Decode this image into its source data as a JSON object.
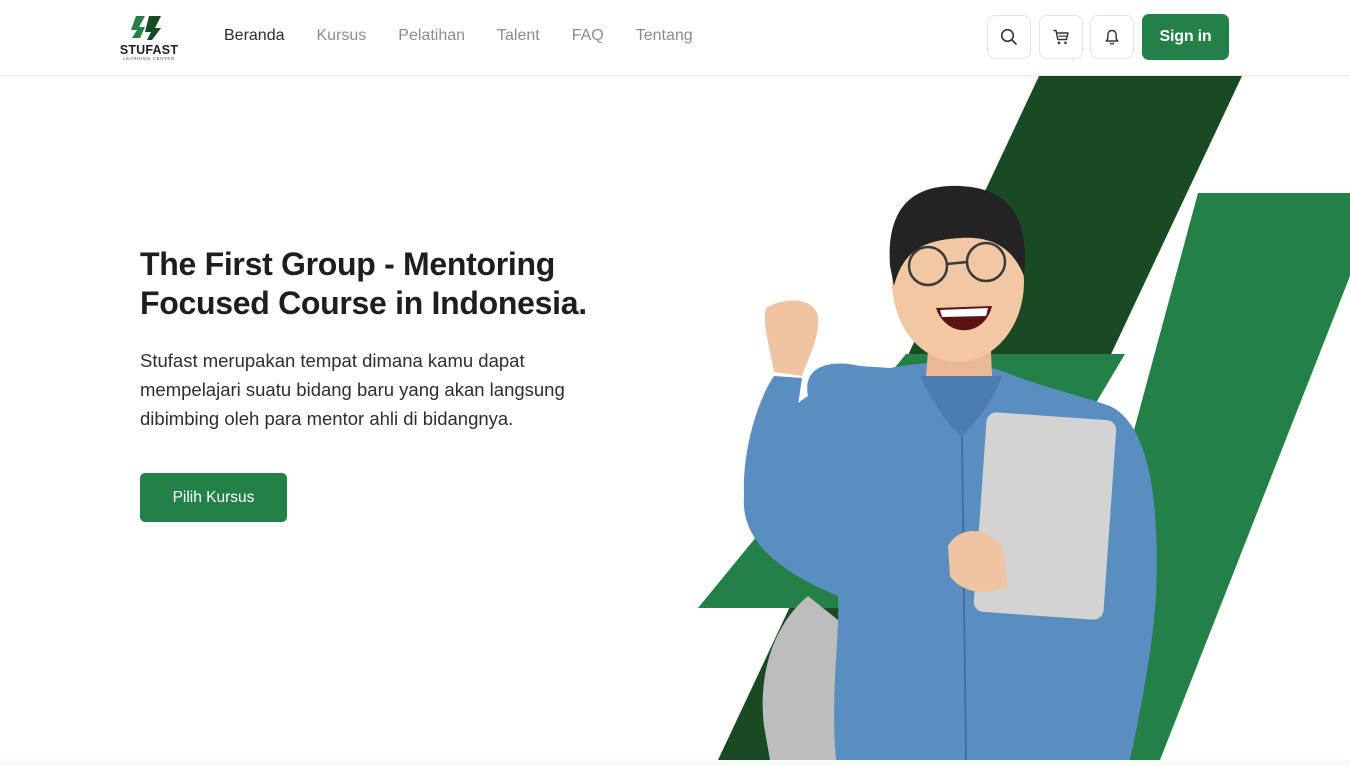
{
  "brand": {
    "name": "STUFAST",
    "tagline": "LEARNING CENTER",
    "color": "#238046"
  },
  "nav": {
    "links": [
      "Beranda",
      "Kursus",
      "Pelatihan",
      "Talent",
      "FAQ",
      "Tentang"
    ],
    "active": "Beranda",
    "icons": [
      "search-icon",
      "cart-icon",
      "bell-icon"
    ],
    "signin_label": "Sign in"
  },
  "hero": {
    "title_line1": "The First Group - Mentoring",
    "title_line2": "Focused Course in Indonesia.",
    "desc_line1": "Stufast merupakan tempat dimana kamu dapat",
    "desc_line2": "mempelajari suatu bidang baru yang akan langsung",
    "desc_line3": "dibimbing oleh para mentor ahli di bidangnya.",
    "cta_label": "Pilih Kursus",
    "stripe_colors": [
      "#1a4a24",
      "#238046"
    ]
  }
}
